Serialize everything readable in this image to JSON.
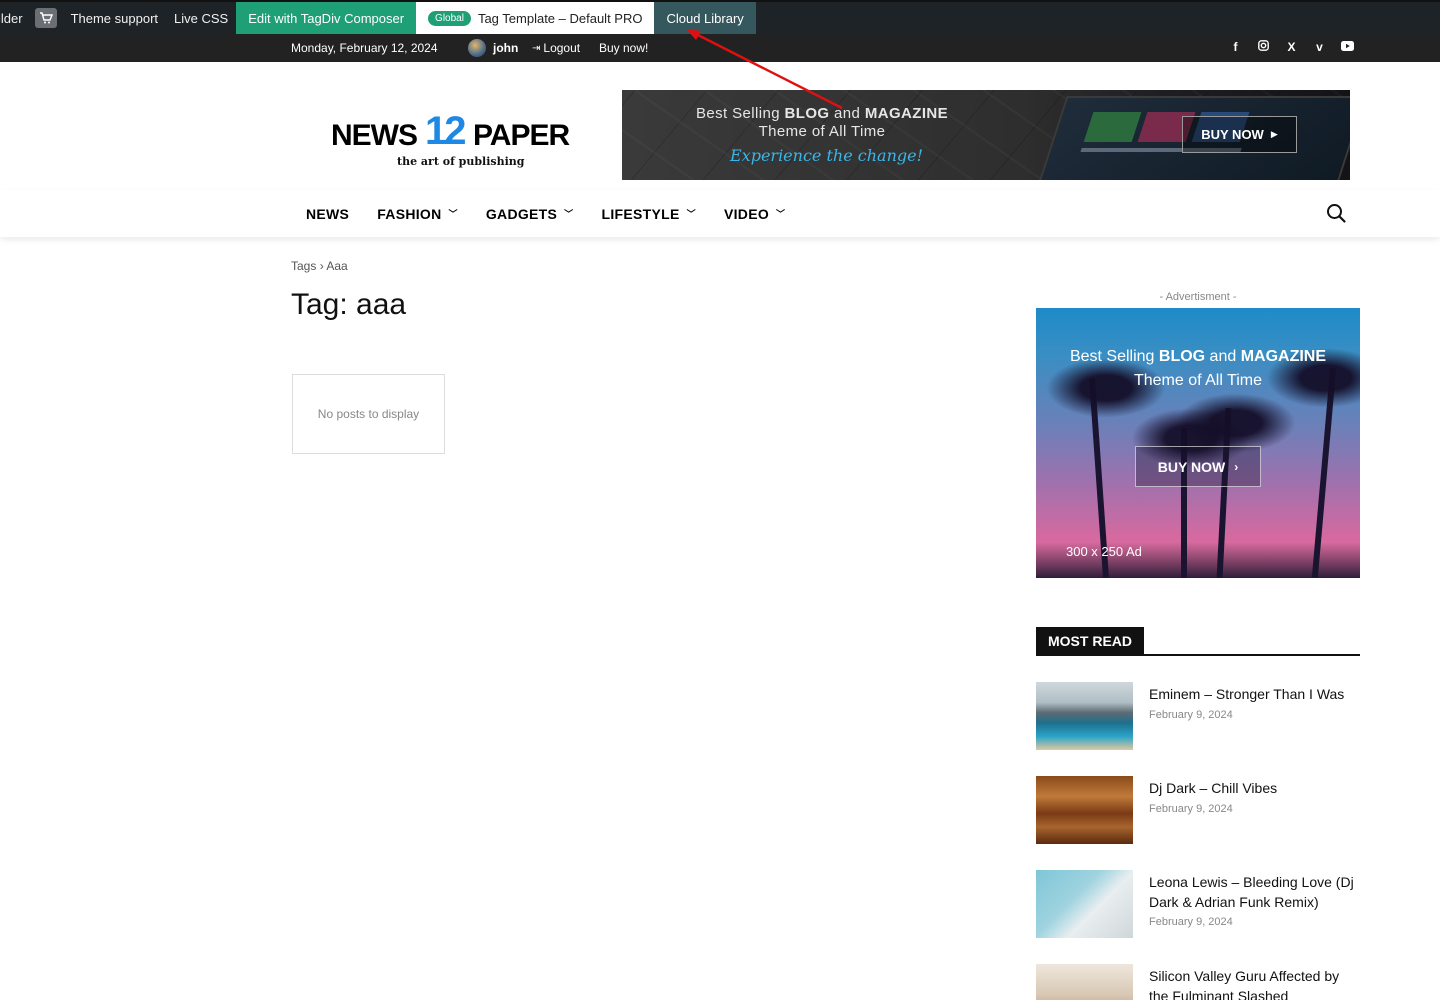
{
  "adminbar": {
    "cut_label": "ilder",
    "theme_support": "Theme support",
    "live_css": "Live CSS",
    "edit_composer": "Edit with TagDiv Composer",
    "global_pill": "Global",
    "template_label": "Tag Template – Default PRO",
    "cloud_library": "Cloud Library"
  },
  "topbar": {
    "date": "Monday, February 12, 2024",
    "username": "john",
    "logout": "Logout",
    "buy_now": "Buy now!",
    "social_icons": [
      "facebook-icon",
      "instagram-icon",
      "x-icon",
      "vimeo-icon",
      "youtube-icon"
    ]
  },
  "logo": {
    "word1": "NEWS",
    "number": "12",
    "word2": "PAPER",
    "tagline": "the art of publishing"
  },
  "header_banner": {
    "line1_prefix": "Best Selling ",
    "line1_b1": "BLOG",
    "line1_mid": " and ",
    "line1_b2": "MAGAZINE",
    "line2": "Theme of All Time",
    "line3": "Experience the change!",
    "button": "BUY NOW"
  },
  "nav": {
    "items": [
      {
        "label": "NEWS",
        "dropdown": false
      },
      {
        "label": "FASHION",
        "dropdown": true
      },
      {
        "label": "GADGETS",
        "dropdown": true
      },
      {
        "label": "LIFESTYLE",
        "dropdown": true
      },
      {
        "label": "VIDEO",
        "dropdown": true
      }
    ]
  },
  "breadcrumb": {
    "root": "Tags",
    "separator": "›",
    "current": "Aaa"
  },
  "page": {
    "title": "Tag: aaa",
    "empty_message": "No posts to display"
  },
  "sidebar": {
    "ad_label": "- Advertisment -",
    "ad": {
      "line1_prefix": "Best Selling ",
      "line1_b1": "BLOG",
      "line1_mid": " and ",
      "line1_b2": "MAGAZINE",
      "line2": "Theme of All Time",
      "button": "BUY NOW",
      "size": "300 x 250 Ad"
    },
    "most_read": {
      "heading": "MOST READ",
      "posts": [
        {
          "title": "Eminem – Stronger Than I Was",
          "date": "February 9, 2024"
        },
        {
          "title": "Dj Dark – Chill Vibes",
          "date": "February 9, 2024"
        },
        {
          "title": "Leona Lewis – Bleeding Love (Dj Dark & Adrian Funk Remix)",
          "date": "February 9, 2024"
        },
        {
          "title": "Silicon Valley Guru Affected by the Fulminant Slashed",
          "date": ""
        }
      ]
    }
  },
  "colors": {
    "admin_bg": "#1d2327",
    "composer_green": "#1e9f75",
    "cloud_teal": "#35585e",
    "topbar_bg": "#222222",
    "logo_blue": "#1e88e5",
    "annotation_red": "#e01010"
  }
}
